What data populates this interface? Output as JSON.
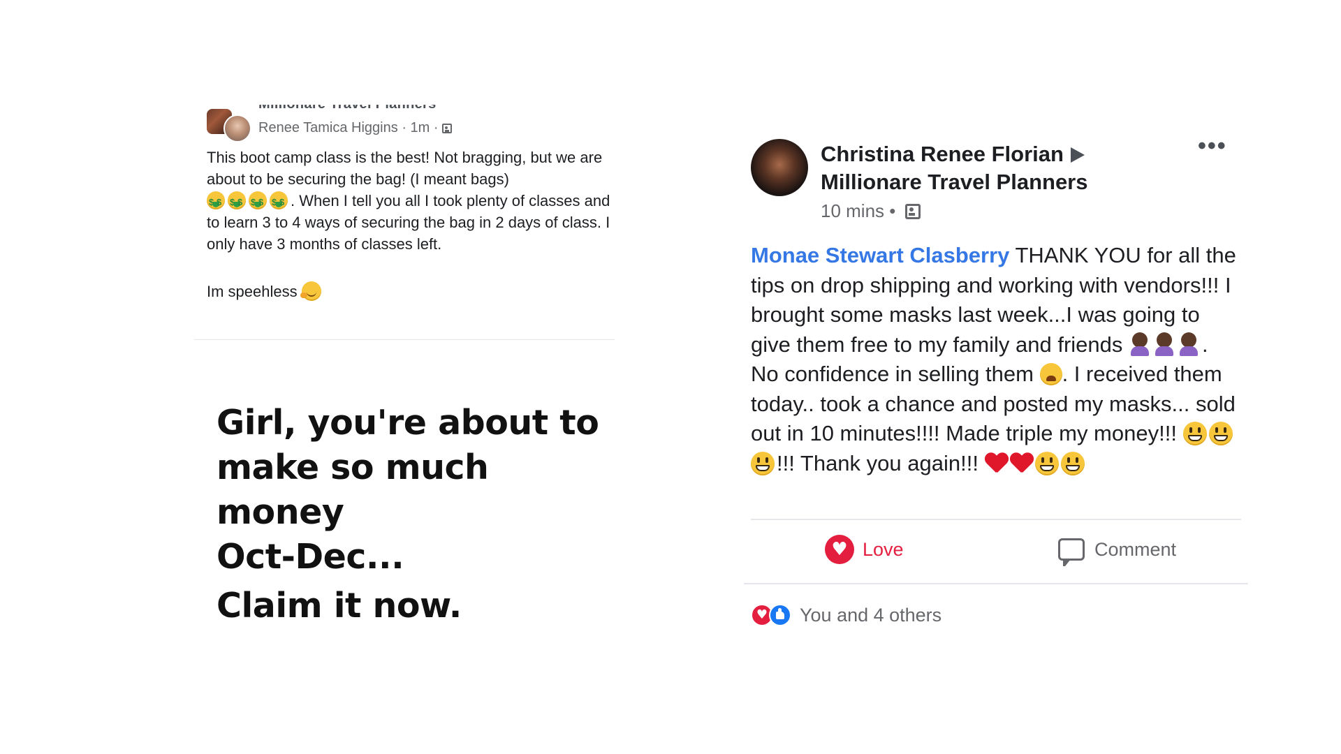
{
  "left_post": {
    "group_name": "Millionare Travel Planners",
    "author": "Renee Tamica Higgins",
    "time": "1m",
    "separator": "·",
    "body_line1": "This boot camp class is the best! Not bragging,  but we are about to be securing the bag! (I meant bags)",
    "body_line2_suffix": ". When I tell  you all I took plenty of classes and to learn 3 to 4 ways of securing the bag in 2 days of class. I only have 3 months of classes left.",
    "body_line3": "Im speehless",
    "emoji_money_count": 4,
    "icons": [
      "group-avatar",
      "user-avatar",
      "group-privacy-icon",
      "money-mouth-face-emoji",
      "hugging-face-emoji"
    ],
    "promo": {
      "line1": "Girl, you're about to",
      "line2": "make so much money",
      "line3": "Oct-Dec...",
      "line4": "Claim it now."
    }
  },
  "right_post": {
    "author": "Christina Renee Florian",
    "group": "Millionare Travel Planners",
    "time": "10 mins",
    "separator": "•",
    "more": "•••",
    "mention": "Monae Stewart Clasberry",
    "text1": " THANK YOU for all the tips on drop shipping and working with vendors!!! I brought some masks last week...I was going to give them free to my family and friends ",
    "text2": ". No confidence in selling them ",
    "text3": ".  I received them today.. took a chance and posted my masks... sold out in 10 minutes!!!! Made triple my money!!! ",
    "text4": "!!! Thank you again!!! ",
    "actions": {
      "love_label": "Love",
      "comment_label": "Comment"
    },
    "reactions_text": "You and 4 others",
    "colors": {
      "mention": "#3578e5",
      "love": "#e41e3f",
      "like": "#1877f2",
      "meta": "#65676b"
    },
    "icons": [
      "profile-avatar",
      "triangle-arrow-icon",
      "group-privacy-icon",
      "more-options-icon",
      "woman-facepalming-emoji",
      "weary-face-emoji",
      "grinning-face-emoji",
      "red-heart-emoji",
      "love-reaction-icon",
      "comment-icon",
      "like-reaction-icon"
    ]
  }
}
